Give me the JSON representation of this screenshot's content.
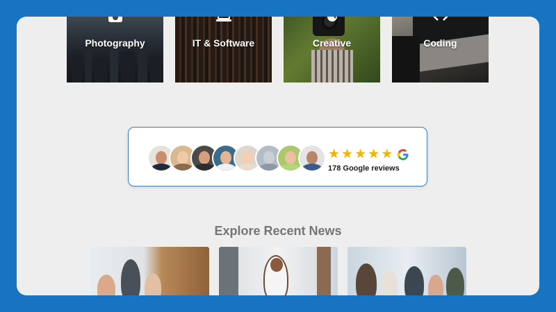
{
  "categories": [
    {
      "label": "Photography",
      "icon": "camera-icon"
    },
    {
      "label": "IT & Software",
      "icon": "laptop-icon"
    },
    {
      "label": "Creative",
      "icon": "palette-icon"
    },
    {
      "label": "Coding",
      "icon": "code-icon"
    }
  ],
  "reviews": {
    "count_text": "178 Google reviews",
    "stars": 5,
    "star_color": "#f4b400",
    "avatars": [
      "avatar-1",
      "avatar-2",
      "avatar-3",
      "avatar-4",
      "avatar-5",
      "avatar-6",
      "avatar-7",
      "avatar-8"
    ]
  },
  "news": {
    "heading": "Explore Recent News"
  },
  "colors": {
    "frame": "#1674c3",
    "panel": "#eeeeee",
    "card_border": "#3f79c2"
  }
}
